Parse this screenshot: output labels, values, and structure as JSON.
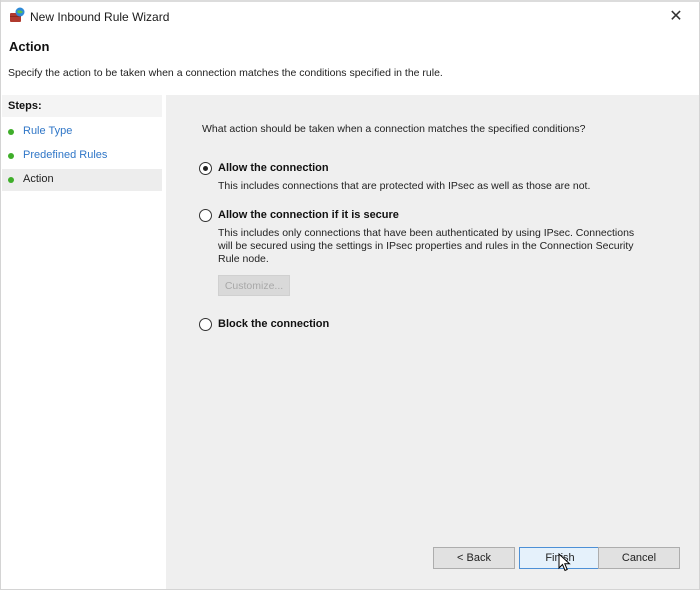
{
  "window": {
    "title": "New Inbound Rule Wizard",
    "icon": "firewall-icon",
    "close_icon": "close-icon",
    "close_glyph": "✕"
  },
  "header": {
    "title": "Action",
    "description": "Specify the action to be taken when a connection matches the conditions specified in the rule."
  },
  "steps": {
    "heading": "Steps:",
    "items": [
      {
        "label": "Rule Type",
        "state": "completed"
      },
      {
        "label": "Predefined Rules",
        "state": "completed"
      },
      {
        "label": "Action",
        "state": "current"
      }
    ],
    "status_color": "#3fae2a",
    "link_color": "#2f76c7"
  },
  "content": {
    "question": "What action should be taken when a connection matches the specified conditions?",
    "options": [
      {
        "label": "Allow the connection",
        "description": "This includes connections that are protected with IPsec as well as those are not.",
        "selected": true
      },
      {
        "label": "Allow the connection if it is secure",
        "description": "This includes only connections that have been authenticated by using IPsec.  Connections will be secured using the settings in IPsec properties and rules in the Connection Security Rule node.",
        "selected": false
      },
      {
        "label": "Block the connection",
        "description": "",
        "selected": false
      }
    ],
    "customize_button": {
      "label": "Customize...",
      "enabled": false
    }
  },
  "footer": {
    "back_label": "< Back",
    "finish_label": "Finish",
    "cancel_label": "Cancel"
  }
}
